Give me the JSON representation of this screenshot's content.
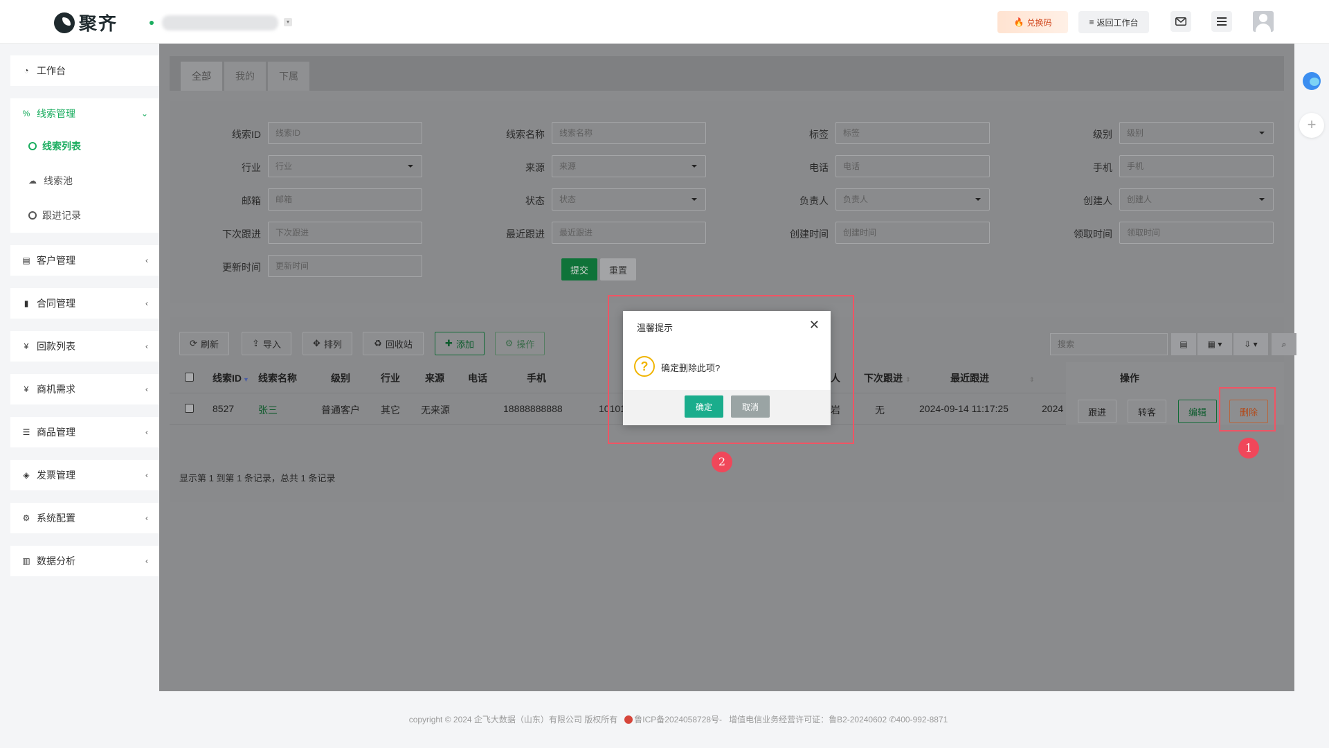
{
  "header": {
    "brand": "聚齐",
    "redeem_label": "兑换码",
    "back_label": "返回工作台"
  },
  "sidebar": {
    "items": [
      {
        "label": "工作台"
      },
      {
        "label": "线索管理",
        "subitems": [
          {
            "label": "线索列表"
          },
          {
            "label": "线索池"
          },
          {
            "label": "跟进记录"
          }
        ]
      },
      {
        "label": "客户管理"
      },
      {
        "label": "合同管理"
      },
      {
        "label": "回款列表"
      },
      {
        "label": "商机需求"
      },
      {
        "label": "商品管理"
      },
      {
        "label": "发票管理"
      },
      {
        "label": "系统配置"
      },
      {
        "label": "数据分析"
      }
    ]
  },
  "tabs": [
    "全部",
    "我的",
    "下属"
  ],
  "filters": {
    "row1": [
      {
        "label": "线索ID",
        "placeholder": "线索ID"
      },
      {
        "label": "线索名称",
        "placeholder": "线索名称"
      },
      {
        "label": "标签",
        "placeholder": "标签"
      },
      {
        "label": "级别",
        "placeholder": "级别"
      }
    ],
    "row2": [
      {
        "label": "行业",
        "placeholder": "行业"
      },
      {
        "label": "来源",
        "placeholder": "来源"
      },
      {
        "label": "电话",
        "placeholder": "电话"
      },
      {
        "label": "手机",
        "placeholder": "手机"
      }
    ],
    "row3": [
      {
        "label": "邮箱",
        "placeholder": "邮箱"
      },
      {
        "label": "状态",
        "placeholder": "状态"
      },
      {
        "label": "负责人",
        "placeholder": "负责人"
      },
      {
        "label": "创建人",
        "placeholder": "创建人"
      }
    ],
    "row4": [
      {
        "label": "下次跟进",
        "placeholder": "下次跟进"
      },
      {
        "label": "最近跟进",
        "placeholder": "最近跟进"
      },
      {
        "label": "创建时间",
        "placeholder": "创建时间"
      },
      {
        "label": "领取时间",
        "placeholder": "领取时间"
      }
    ],
    "row5": [
      {
        "label": "更新时间",
        "placeholder": "更新时间"
      }
    ],
    "submit_label": "提交",
    "reset_label": "重置"
  },
  "toolbar": {
    "refresh": "刷新",
    "import": "导入",
    "sort": "排列",
    "recycle": "回收站",
    "add": "添加",
    "operate": "操作",
    "search_placeholder": "搜索"
  },
  "table": {
    "headers": {
      "id": "线索ID",
      "name": "线索名称",
      "level": "级别",
      "industry": "行业",
      "source": "来源",
      "phone": "电话",
      "mobile": "手机",
      "owner_partial": "人",
      "next_follow": "下次跟进",
      "last_follow": "最近跟进",
      "ops": "操作"
    },
    "rows": [
      {
        "id": "8527",
        "name": "张三",
        "level": "普通客户",
        "industry": "其它",
        "source": "无来源",
        "phone": "",
        "mobile": "18888888888",
        "tel_partial": "101011",
        "owner_partial": "岩",
        "next_follow": "无",
        "last_follow": "2024-09-14 11:17:25",
        "created_partial": "2024"
      }
    ],
    "row_buttons": {
      "follow": "跟进",
      "convert": "转客",
      "edit": "编辑",
      "delete": "删除"
    },
    "summary": "显示第 1 到第 1 条记录，总共 1 条记录"
  },
  "dialog": {
    "title": "温馨提示",
    "message": "确定删除此项?",
    "ok": "确定",
    "cancel": "取消"
  },
  "annotations": {
    "one": "1",
    "two": "2"
  },
  "footer": {
    "copyright": "copyright © 2024 企飞大数据（山东）有限公司 版权所有",
    "icp": "鲁ICP备2024058728号-",
    "license": "增值电信业务经营许可证：鲁B2-20240602",
    "phone": "400-992-8871"
  },
  "colors": {
    "brand_green": "#1aad5f",
    "dialog_ok": "#1aad8c",
    "annotation_red": "#f05464"
  }
}
